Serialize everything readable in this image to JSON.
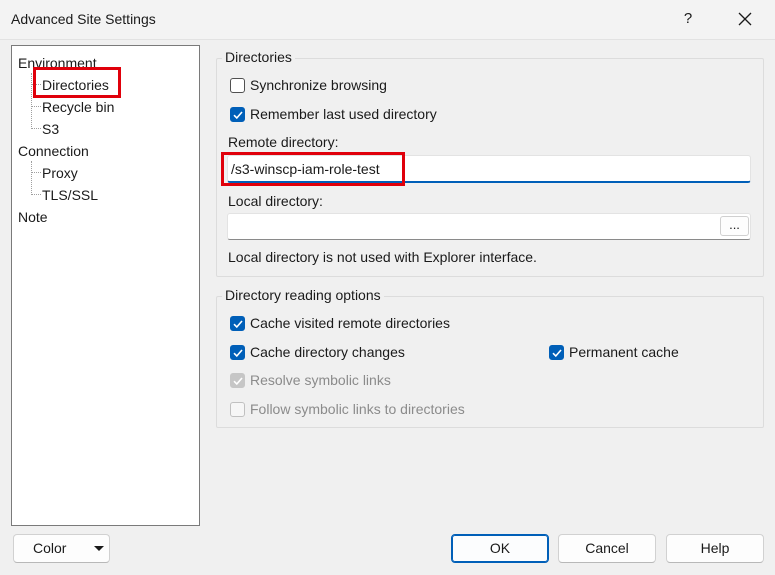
{
  "window": {
    "title": "Advanced Site Settings",
    "help_label": "?",
    "close_icon": "close-icon"
  },
  "tree": {
    "items": [
      {
        "label": "Environment"
      },
      {
        "label": "Directories",
        "selected": true
      },
      {
        "label": "Recycle bin"
      },
      {
        "label": "S3"
      },
      {
        "label": "Connection"
      },
      {
        "label": "Proxy"
      },
      {
        "label": "TLS/SSL"
      },
      {
        "label": "Note"
      }
    ]
  },
  "directories": {
    "group_title": "Directories",
    "sync_browsing": {
      "label": "Synchronize browsing",
      "checked": false
    },
    "remember_last": {
      "label": "Remember last used directory",
      "checked": true
    },
    "remote_label": "Remote directory:",
    "remote_value": "/s3-winscp-iam-role-test",
    "local_label": "Local directory:",
    "local_value": "",
    "browse_label": "...",
    "note": "Local directory is not used with Explorer interface."
  },
  "reading": {
    "group_title": "Directory reading options",
    "cache_visited": {
      "label": "Cache visited remote directories",
      "checked": true
    },
    "cache_changes": {
      "label": "Cache directory changes",
      "checked": true
    },
    "permanent_cache": {
      "label": "Permanent cache",
      "checked": true
    },
    "resolve_links": {
      "label": "Resolve symbolic links",
      "checked": true,
      "disabled": true
    },
    "follow_links": {
      "label": "Follow symbolic links to directories",
      "checked": false,
      "disabled": true
    }
  },
  "footer": {
    "color_label": "Color",
    "ok_label": "OK",
    "cancel_label": "Cancel",
    "help_label": "Help"
  },
  "colors": {
    "accent": "#005fb8",
    "highlight": "#e0000b"
  }
}
